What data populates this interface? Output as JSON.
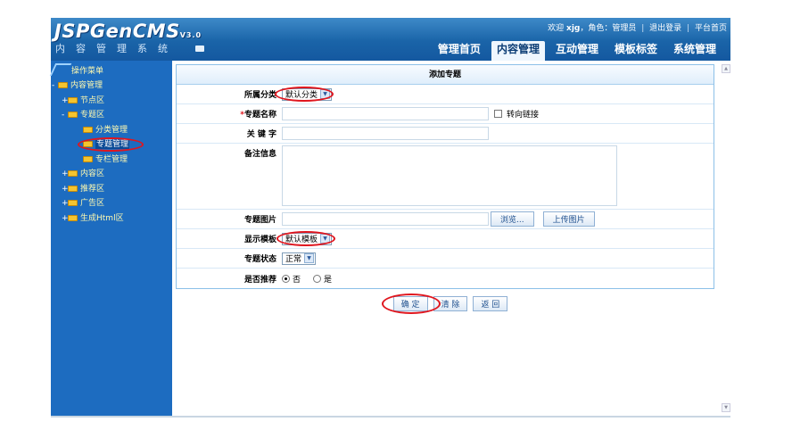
{
  "header": {
    "logo": "JSPGenCMS",
    "version": "V3.0",
    "subtitle": "内容管理系统",
    "welcome": "欢迎",
    "username": "xjg",
    "role_text": "，角色：管理员",
    "logout": "退出登录",
    "homepage": "平台首页",
    "sep": "|",
    "nav": [
      "管理首页",
      "内容管理",
      "互动管理",
      "模板标签",
      "系统管理"
    ]
  },
  "sidebar": {
    "title": "操作菜单",
    "items": [
      {
        "label": "内容管理",
        "pm": "-"
      },
      {
        "label": "节点区",
        "pm": "+"
      },
      {
        "label": "专题区",
        "pm": "-"
      },
      {
        "label": "分类管理"
      },
      {
        "label": "专题管理"
      },
      {
        "label": "专栏管理"
      },
      {
        "label": "内容区",
        "pm": "+"
      },
      {
        "label": "推荐区",
        "pm": "+"
      },
      {
        "label": "广告区",
        "pm": "+"
      },
      {
        "label": "生成Html区",
        "pm": "+"
      }
    ]
  },
  "form": {
    "title": "添加专题",
    "category_label": "所属分类",
    "category_value": "默认分类",
    "name_label": "专题名称",
    "name_req": "*",
    "redirect_label": "转向链接",
    "keywords_label": "关 键 字",
    "notes_label": "备注信息",
    "image_label": "专题图片",
    "browse_label": "浏览...",
    "upload_label": "上传图片",
    "template_label": "显示模板",
    "template_value": "默认模板",
    "status_label": "专题状态",
    "status_value": "正常",
    "recommend_label": "是否推荐",
    "recommend_no": "否",
    "recommend_yes": "是"
  },
  "actions": {
    "confirm": "确 定",
    "clear": "清 除",
    "back": "返 回"
  },
  "colors": {
    "header": "#1a64a8",
    "sidebar": "#1d6cc0",
    "highlight": "#e0161e"
  }
}
